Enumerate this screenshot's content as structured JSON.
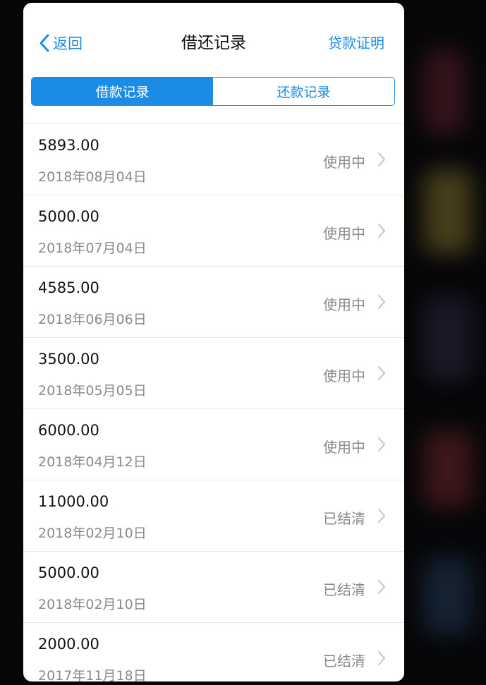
{
  "nav": {
    "back_label": "返回",
    "title": "借还记录",
    "right_action": "贷款证明"
  },
  "tabs": [
    {
      "label": "借款记录",
      "active": true
    },
    {
      "label": "还款记录",
      "active": false
    }
  ],
  "records": [
    {
      "amount": "5893.00",
      "date": "2018年08月04日",
      "status": "使用中"
    },
    {
      "amount": "5000.00",
      "date": "2018年07月04日",
      "status": "使用中"
    },
    {
      "amount": "4585.00",
      "date": "2018年06月06日",
      "status": "使用中"
    },
    {
      "amount": "3500.00",
      "date": "2018年05月05日",
      "status": "使用中"
    },
    {
      "amount": "6000.00",
      "date": "2018年04月12日",
      "status": "使用中"
    },
    {
      "amount": "11000.00",
      "date": "2018年02月10日",
      "status": "已结清"
    },
    {
      "amount": "5000.00",
      "date": "2018年02月10日",
      "status": "已结清"
    },
    {
      "amount": "2000.00",
      "date": "2017年11月18日",
      "status": "已结清"
    }
  ],
  "colors": {
    "accent": "#1b8ce6",
    "secondary_text": "#8a8a8a",
    "primary_text": "#111111"
  }
}
